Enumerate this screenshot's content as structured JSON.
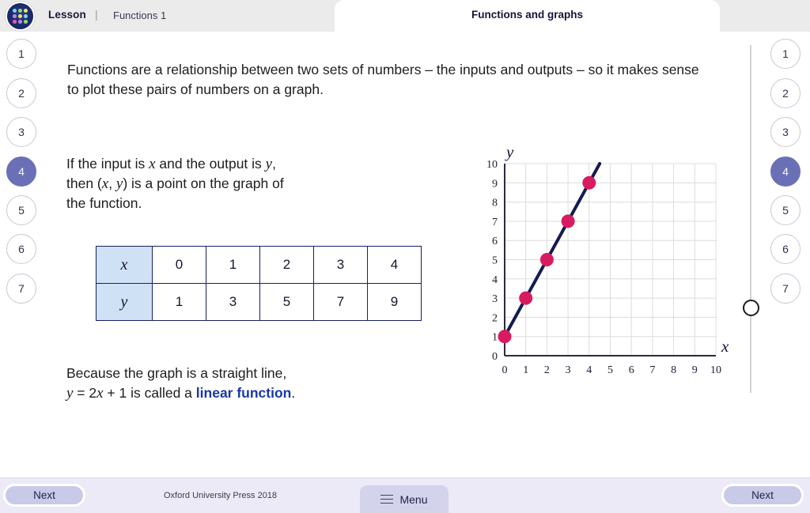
{
  "header": {
    "breadcrumb_lesson": "Lesson",
    "breadcrumb_separator": "|",
    "breadcrumb_page": "Functions 1",
    "title": "Functions and graphs",
    "logo_name": "oxford-dots-logo"
  },
  "nav": {
    "items": [
      "1",
      "2",
      "3",
      "4",
      "5",
      "6",
      "7"
    ],
    "active_index": 3,
    "active_color": "#6a70b5"
  },
  "content": {
    "intro_paragraph": "Functions are a relationship between two sets of numbers – the inputs and outputs – so it makes sense to plot these pairs of numbers on a graph.",
    "middle": {
      "line1_a": "If the input is ",
      "line1_x": "x",
      "line1_b": " and the output is ",
      "line1_y": "y",
      "line1_c": ",",
      "line2_a": "then (",
      "line2_x": "x",
      "line2_comma": ", ",
      "line2_y": "y",
      "line2_b": ") is a point on the graph of",
      "line3": "the function."
    },
    "bottom": {
      "line1": "Because the graph is a straight line,",
      "line2_y": "y",
      "line2_a": " = 2",
      "line2_x": "x",
      "line2_b": " + 1 is called a ",
      "line2_link": "linear function",
      "line2_c": ".",
      "link_color": "#1838a8"
    }
  },
  "table": {
    "row_x_label": "x",
    "row_y_label": "y",
    "row_x_values": [
      "0",
      "1",
      "2",
      "3",
      "4"
    ],
    "row_y_values": [
      "1",
      "3",
      "5",
      "7",
      "9"
    ],
    "header_fill": "#cfe2f5",
    "border_color": "#1b1f63"
  },
  "chart_data": {
    "type": "line",
    "title": "",
    "xlabel": "x",
    "ylabel": "y",
    "xlim": [
      0,
      10
    ],
    "ylim": [
      0,
      10
    ],
    "xticks": [
      "0",
      "1",
      "2",
      "3",
      "4",
      "5",
      "6",
      "7",
      "8",
      "9",
      "10"
    ],
    "yticks": [
      "0",
      "1",
      "2",
      "3",
      "4",
      "5",
      "6",
      "7",
      "8",
      "9",
      "10"
    ],
    "grid": true,
    "grid_color": "#dcdcdc",
    "axis_color": "#2b2b3f",
    "line_color": "#151a52",
    "point_color": "#d81b60",
    "legend": "none",
    "series": [
      {
        "name": "y = 2x + 1",
        "x": [
          0,
          1,
          2,
          3,
          4
        ],
        "y": [
          1,
          3,
          5,
          7,
          9
        ]
      }
    ],
    "line_extent": {
      "x0": 0,
      "y0": 1,
      "x1": 4.5,
      "y1": 10
    }
  },
  "footer": {
    "next_left_label": "Next",
    "next_right_label": "Next",
    "copyright": "Oxford University Press 2018",
    "menu_label": "Menu"
  }
}
